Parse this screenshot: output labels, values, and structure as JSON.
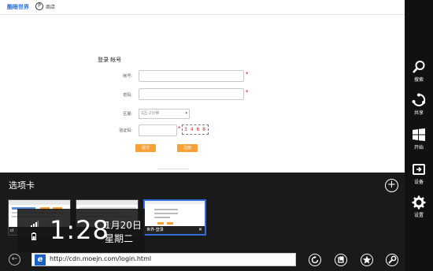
{
  "page": {
    "site_logo": "酷眼世界",
    "site_p": "P",
    "site_link": "商店",
    "form_title": "登录 帐号",
    "labels": {
      "account": "帐号:",
      "password": "密码:",
      "region": "区服:",
      "captcha": "验证码:"
    },
    "region_value": "1区-2分钟",
    "captcha_text": "3 4 6 8",
    "required_mark": "*",
    "submit_label": "提交",
    "register_label": "注册"
  },
  "charms": [
    {
      "label": "搜索",
      "icon": "search-icon"
    },
    {
      "label": "共享",
      "icon": "share-icon"
    },
    {
      "label": "开始",
      "icon": "windows-icon"
    },
    {
      "label": "设备",
      "icon": "devices-icon"
    },
    {
      "label": "设置",
      "icon": "gear-icon"
    }
  ],
  "tabs": {
    "title": "选项卡",
    "add_label": "+",
    "items": [
      {
        "caption": "cl"
      },
      {
        "caption": ""
      },
      {
        "caption": "世界-登录",
        "close": "✕"
      }
    ]
  },
  "clock": {
    "time": "1:28",
    "date": "1月20日",
    "day": "星期二"
  },
  "address": {
    "url": "http://cdn.moejn.com/login.html",
    "ie_glyph": "e",
    "back_glyph": "←"
  },
  "colors": {
    "accent_orange": "#f7a035",
    "ie_blue": "#1b62c7",
    "active_tab_border": "#2e6fd8"
  }
}
